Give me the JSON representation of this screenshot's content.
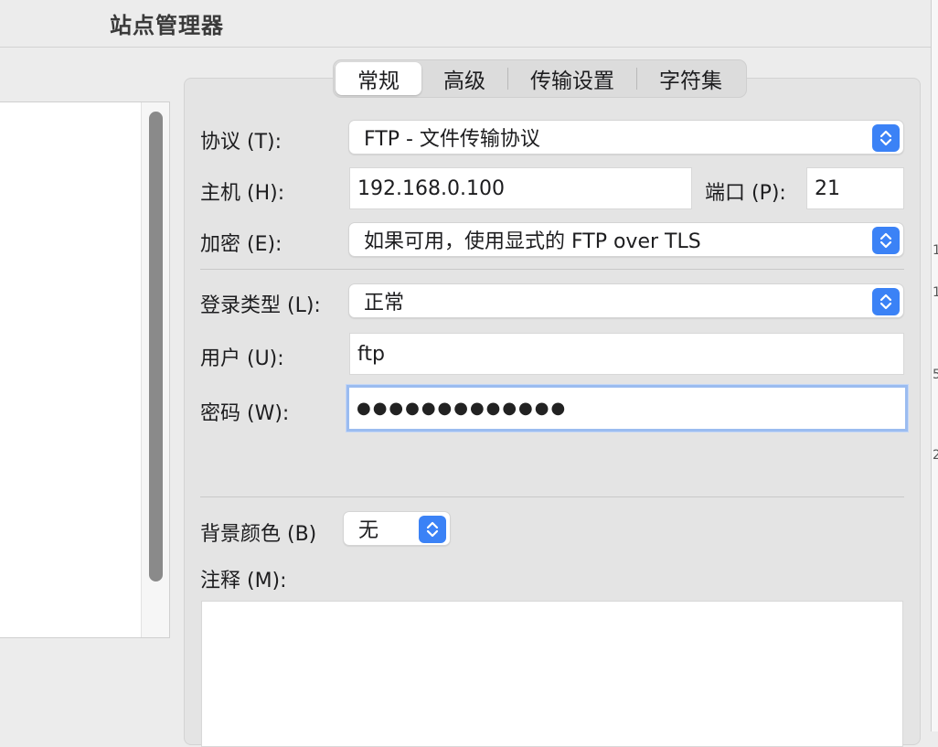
{
  "window": {
    "title": "站点管理器"
  },
  "tabs": [
    {
      "label": "常规",
      "active": true
    },
    {
      "label": "高级",
      "active": false
    },
    {
      "label": "传输设置",
      "active": false
    },
    {
      "label": "字符集",
      "active": false
    }
  ],
  "general": {
    "protocol_label": "协议 (T):",
    "protocol_value": "FTP - 文件传输协议",
    "host_label": "主机 (H):",
    "host_value": "192.168.0.100",
    "port_label": "端口 (P):",
    "port_value": "21",
    "encryption_label": "加密 (E):",
    "encryption_value": "如果可用，使用显式的 FTP over TLS",
    "logon_type_label": "登录类型 (L):",
    "logon_type_value": "正常",
    "user_label": "用户 (U):",
    "user_value": "ftp",
    "password_label": "密码 (W):",
    "password_value": "●●●●●●●●●●●●●",
    "bg_color_label": "背景颜色 (B)",
    "bg_color_value": "无",
    "comment_label": "注释 (M):"
  },
  "colors": {
    "accent": "#3b82f6",
    "focus_ring": "#9bbcf0"
  }
}
